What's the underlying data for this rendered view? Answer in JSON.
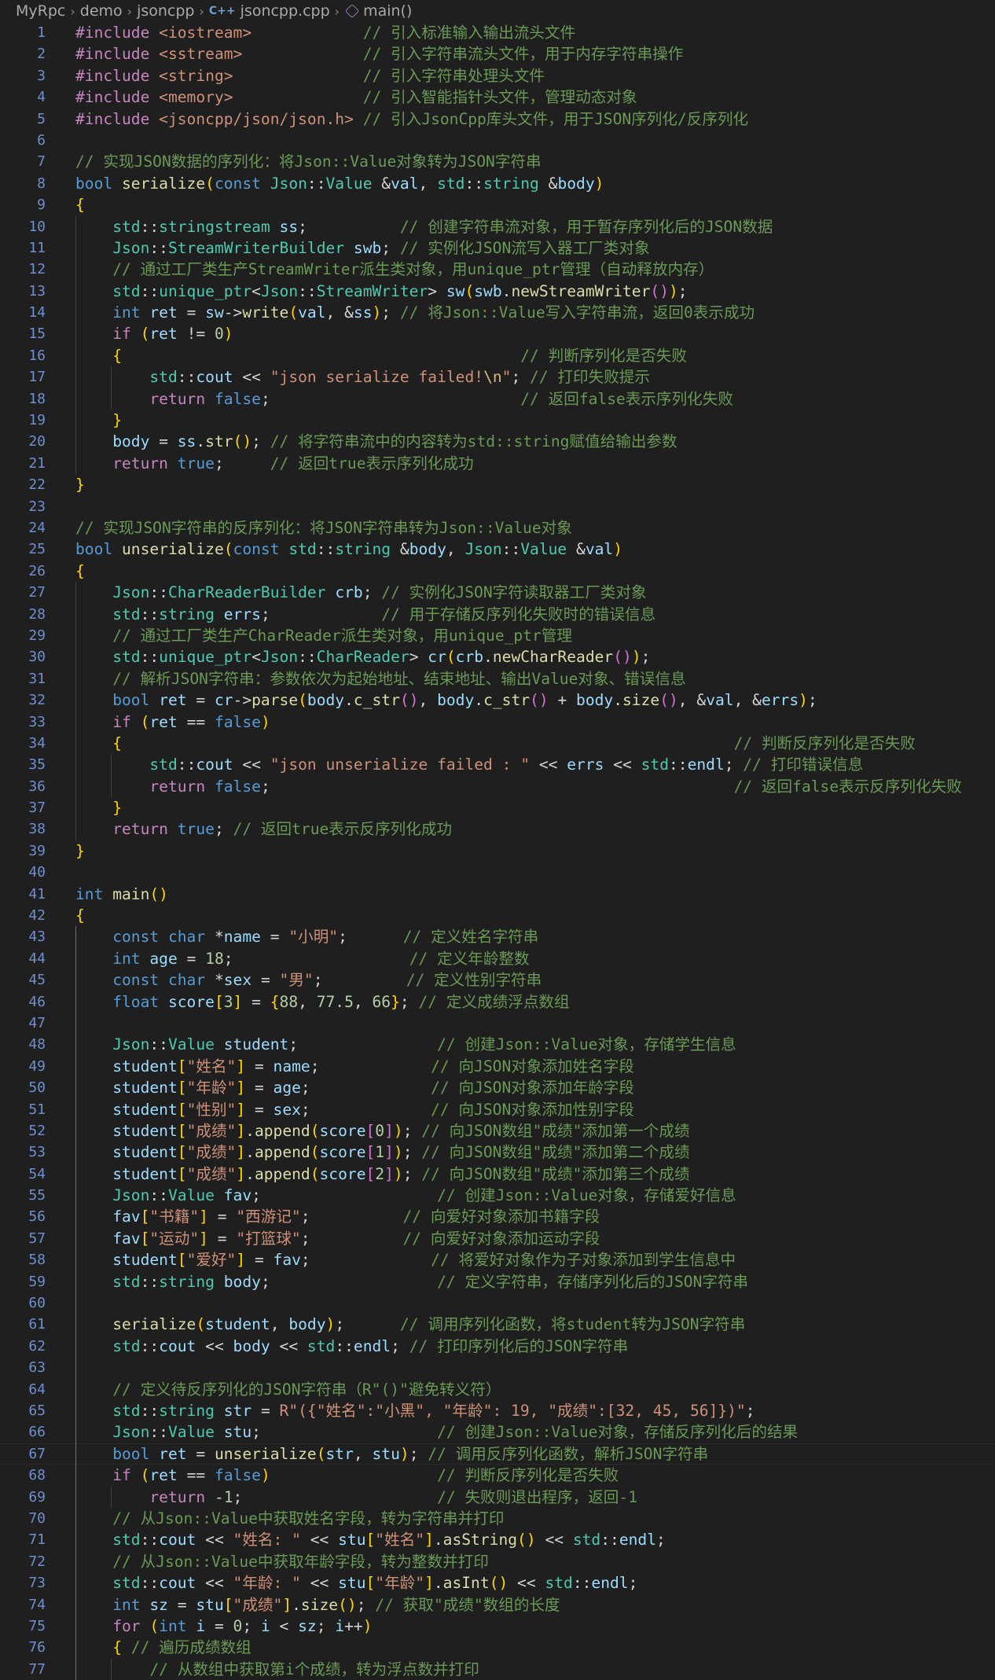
{
  "breadcrumb": {
    "items": [
      "MyRpc",
      "demo",
      "jsoncpp",
      "jsoncpp.cpp",
      "main()"
    ]
  },
  "editor": {
    "language": "cpp",
    "active_line": 67,
    "lines": [
      "#include <iostream>            // 引入标准输入输出流头文件",
      "#include <sstream>             // 引入字符串流头文件，用于内存字符串操作",
      "#include <string>              // 引入字符串处理头文件",
      "#include <memory>              // 引入智能指针头文件，管理动态对象",
      "#include <jsoncpp/json/json.h> // 引入JsonCpp库头文件，用于JSON序列化/反序列化",
      "",
      "// 实现JSON数据的序列化：将Json::Value对象转为JSON字符串",
      "bool serialize(const Json::Value &val, std::string &body)",
      "{",
      "    std::stringstream ss;          // 创建字符串流对象，用于暂存序列化后的JSON数据",
      "    Json::StreamWriterBuilder swb; // 实例化JSON流写入器工厂类对象",
      "    // 通过工厂类生产StreamWriter派生类对象，用unique_ptr管理（自动释放内存）",
      "    std::unique_ptr<Json::StreamWriter> sw(swb.newStreamWriter());",
      "    int ret = sw->write(val, &ss); // 将Json::Value写入字符串流，返回0表示成功",
      "    if (ret != 0)",
      "    {                                           // 判断序列化是否失败",
      "        std::cout << \"json serialize failed!\\n\"; // 打印失败提示",
      "        return false;                           // 返回false表示序列化失败",
      "    }",
      "    body = ss.str(); // 将字符串流中的内容转为std::string赋值给输出参数",
      "    return true;     // 返回true表示序列化成功",
      "}",
      "",
      "// 实现JSON字符串的反序列化：将JSON字符串转为Json::Value对象",
      "bool unserialize(const std::string &body, Json::Value &val)",
      "{",
      "    Json::CharReaderBuilder crb; // 实例化JSON字符读取器工厂类对象",
      "    std::string errs;            // 用于存储反序列化失败时的错误信息",
      "    // 通过工厂类生产CharReader派生类对象，用unique_ptr管理",
      "    std::unique_ptr<Json::CharReader> cr(crb.newCharReader());",
      "    // 解析JSON字符串：参数依次为起始地址、结束地址、输出Value对象、错误信息",
      "    bool ret = cr->parse(body.c_str(), body.c_str() + body.size(), &val, &errs);",
      "    if (ret == false)",
      "    {                                                                  // 判断反序列化是否失败",
      "        std::cout << \"json unserialize failed : \" << errs << std::endl; // 打印错误信息",
      "        return false;                                                  // 返回false表示反序列化失败",
      "    }",
      "    return true; // 返回true表示反序列化成功",
      "}",
      "",
      "int main()",
      "{",
      "    const char *name = \"小明\";      // 定义姓名字符串",
      "    int age = 18;                   // 定义年龄整数",
      "    const char *sex = \"男\";         // 定义性别字符串",
      "    float score[3] = {88, 77.5, 66}; // 定义成绩浮点数组",
      "",
      "    Json::Value student;               // 创建Json::Value对象，存储学生信息",
      "    student[\"姓名\"] = name;            // 向JSON对象添加姓名字段",
      "    student[\"年龄\"] = age;             // 向JSON对象添加年龄字段",
      "    student[\"性别\"] = sex;             // 向JSON对象添加性别字段",
      "    student[\"成绩\"].append(score[0]); // 向JSON数组\"成绩\"添加第一个成绩",
      "    student[\"成绩\"].append(score[1]); // 向JSON数组\"成绩\"添加第二个成绩",
      "    student[\"成绩\"].append(score[2]); // 向JSON数组\"成绩\"添加第三个成绩",
      "    Json::Value fav;                   // 创建Json::Value对象，存储爱好信息",
      "    fav[\"书籍\"] = \"西游记\";          // 向爱好对象添加书籍字段",
      "    fav[\"运动\"] = \"打篮球\";          // 向爱好对象添加运动字段",
      "    student[\"爱好\"] = fav;             // 将爱好对象作为子对象添加到学生信息中",
      "    std::string body;                  // 定义字符串，存储序列化后的JSON字符串",
      "",
      "    serialize(student, body);      // 调用序列化函数，将student转为JSON字符串",
      "    std::cout << body << std::endl; // 打印序列化后的JSON字符串",
      "",
      "    // 定义待反序列化的JSON字符串（R\"()\"避免转义符）",
      "    std::string str = R\"({\"姓名\":\"小黑\", \"年龄\": 19, \"成绩\":[32, 45, 56]})\";",
      "    Json::Value stu;                   // 创建Json::Value对象，存储反序列化后的结果",
      "    bool ret = unserialize(str, stu); // 调用反序列化函数，解析JSON字符串",
      "    if (ret == false)                  // 判断反序列化是否失败",
      "        return -1;                     // 失败则退出程序，返回-1",
      "    // 从Json::Value中获取姓名字段，转为字符串并打印",
      "    std::cout << \"姓名: \" << stu[\"姓名\"].asString() << std::endl;",
      "    // 从Json::Value中获取年龄字段，转为整数并打印",
      "    std::cout << \"年龄: \" << stu[\"年龄\"].asInt() << std::endl;",
      "    int sz = stu[\"成绩\"].size(); // 获取\"成绩\"数组的长度",
      "    for (int i = 0; i < sz; i++)",
      "    { // 遍历成绩数组",
      "        // 从数组中获取第i个成绩，转为浮点数并打印"
    ]
  }
}
